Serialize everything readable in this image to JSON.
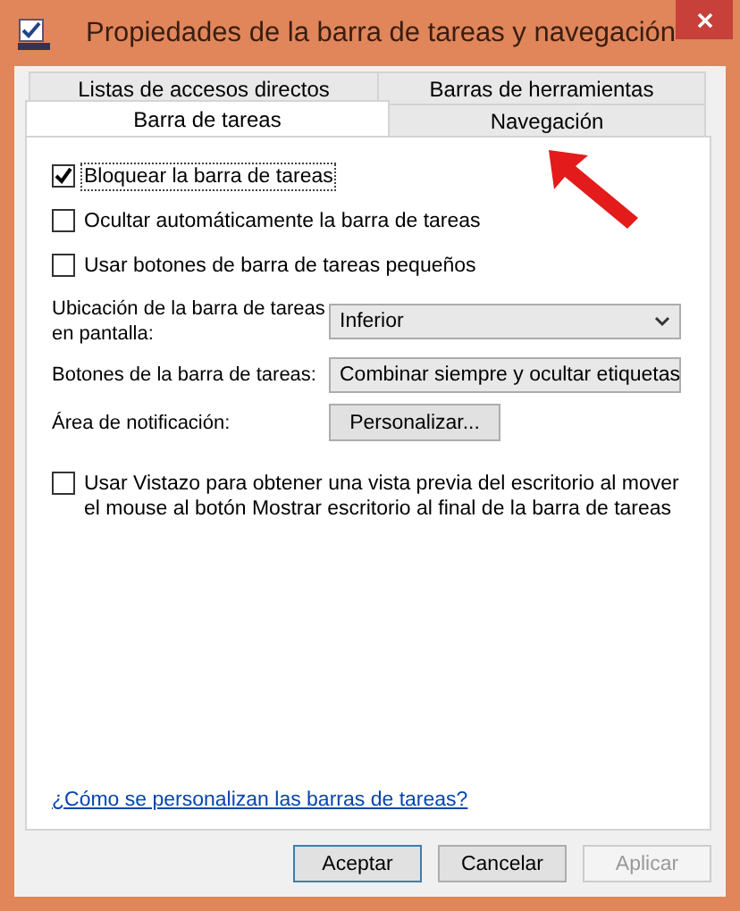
{
  "window": {
    "title": "Propiedades de la barra de tareas y navegación"
  },
  "tab_rows": [
    {
      "tabs": [
        {
          "label": "Listas de accesos directos",
          "selected": false
        },
        {
          "label": "Barras de herramientas",
          "selected": false
        }
      ]
    },
    {
      "tabs": [
        {
          "label": "Barra de tareas",
          "selected": true
        },
        {
          "label": "Navegación",
          "selected": false
        }
      ]
    }
  ],
  "options": [
    {
      "kind": "checkbox",
      "label": "Bloquear la barra de tareas",
      "checked": true,
      "focused": true
    },
    {
      "kind": "checkbox",
      "label": "Ocultar automáticamente la barra de tareas",
      "checked": false,
      "focused": false
    },
    {
      "kind": "checkbox",
      "label": "Usar botones de barra de tareas pequeños",
      "checked": false,
      "focused": false
    },
    {
      "kind": "select",
      "label": "Ubicación de la barra de tareas en pantalla:",
      "value": "Inferior"
    },
    {
      "kind": "select",
      "label": "Botones de la barra de tareas:",
      "value": "Combinar siempre y ocultar etiquetas"
    },
    {
      "kind": "button",
      "label": "Área de notificación:",
      "value": "Personalizar..."
    },
    {
      "kind": "checkbox",
      "label": "Usar Vistazo para obtener una vista previa del escritorio al mover el mouse al botón Mostrar escritorio al final de la barra de tareas",
      "checked": false,
      "focused": false
    }
  ],
  "help_link": "¿Cómo se personalizan las barras de tareas?",
  "buttons": [
    {
      "label": "Aceptar",
      "default": true,
      "disabled": false
    },
    {
      "label": "Cancelar",
      "default": false,
      "disabled": false
    },
    {
      "label": "Aplicar",
      "default": false,
      "disabled": true
    }
  ],
  "annotation": {
    "kind": "arrow"
  }
}
